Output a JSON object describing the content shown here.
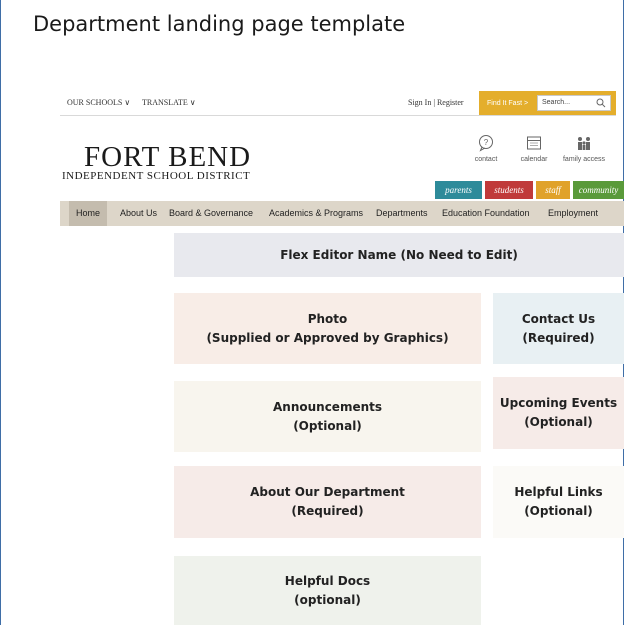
{
  "slide": {
    "title": "Department landing page template"
  },
  "topbar": {
    "our_schools": "OUR SCHOOLS ∨",
    "translate": "TRANSLATE ∨",
    "sign_in": "Sign In | Register",
    "find_it_fast": "Find It Fast >",
    "search_placeholder": "Search...",
    "search_icon": "magnifier-icon"
  },
  "logo": {
    "main": "FORT BEND",
    "sub": "INDEPENDENT SCHOOL DISTRICT"
  },
  "quick_links": [
    {
      "icon": "question-bubble-icon",
      "label": "contact"
    },
    {
      "icon": "calendar-icon",
      "label": "calendar"
    },
    {
      "icon": "family-icon",
      "label": "family access"
    }
  ],
  "audience_tabs": [
    {
      "label": "parents",
      "color": "#2e8b9a"
    },
    {
      "label": "students",
      "color": "#c03a3a"
    },
    {
      "label": "staff",
      "color": "#e0a22a"
    },
    {
      "label": "community",
      "color": "#5a9a3a"
    }
  ],
  "nav": [
    "Home",
    "About Us",
    "Board & Governance",
    "Academics & Programs",
    "Departments",
    "Education Foundation",
    "Employment"
  ],
  "sections": {
    "flex_editor": [
      "Flex Editor Name (No Need to Edit)"
    ],
    "photo": [
      "Photo",
      "(Supplied or Approved by Graphics)"
    ],
    "contact": [
      "Contact Us",
      "(Required)"
    ],
    "announcements": [
      "Announcements",
      "(Optional)"
    ],
    "events": [
      "Upcoming Events",
      "(Optional)"
    ],
    "about": [
      "About Our Department",
      "(Required)"
    ],
    "links": [
      "Helpful Links",
      "(Optional)"
    ],
    "docs": [
      "Helpful Docs",
      "(optional)"
    ]
  },
  "colors": {
    "grey_box": "#e8e9ee",
    "pink_box": "#f8ede7",
    "blue_box": "#e8f0f3",
    "cream_box": "#f8f5ee",
    "rose_box": "#f6ebe8",
    "white_box": "#fbfaf7",
    "green_box": "#eff2ec",
    "gold": "#e4ae2c"
  }
}
